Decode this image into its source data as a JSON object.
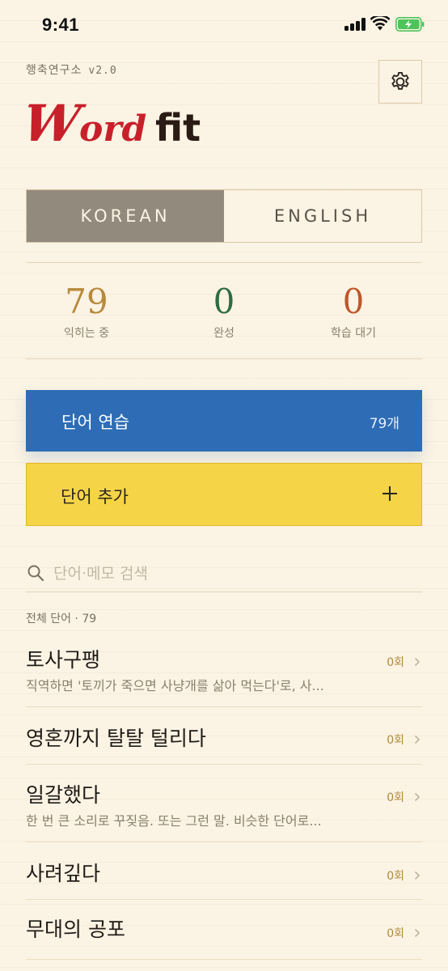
{
  "status_bar": {
    "time": "9:41"
  },
  "header": {
    "org": "행축연구소",
    "version": "v2.0",
    "logo_text": "Wordfit"
  },
  "lang_tabs": [
    {
      "label": "KOREAN",
      "active": true
    },
    {
      "label": "ENGLISH",
      "active": false
    }
  ],
  "stats": [
    {
      "value": "79",
      "label": "익히는 중",
      "color": "#b8893a"
    },
    {
      "value": "0",
      "label": "완성",
      "color": "#2f6b43"
    },
    {
      "value": "0",
      "label": "학습 대기",
      "color": "#c0562a"
    }
  ],
  "practice": {
    "label": "단어 연습",
    "count": "79개"
  },
  "add_word": {
    "label": "단어 추가"
  },
  "search": {
    "placeholder": "단어·메모 검색",
    "value": ""
  },
  "list": {
    "heading": "전체 단어 · 79",
    "items": [
      {
        "word": "토사구팽",
        "desc": "직역하면 '토끼가 죽으면 사냥개를 삶아 먹는다'로, 사...",
        "count": "0회"
      },
      {
        "word": "영혼까지 탈탈 털리다",
        "desc": "",
        "count": "0회"
      },
      {
        "word": "일갈했다",
        "desc": "한 번 큰 소리로 꾸짖음. 또는 그런 말. 비슷한 단어로...",
        "count": "0회"
      },
      {
        "word": "사려깊다",
        "desc": "",
        "count": "0회"
      },
      {
        "word": "무대의 공포",
        "desc": "",
        "count": "0회"
      }
    ]
  },
  "colors": {
    "accent_blue": "#2e6db5",
    "accent_yellow": "#f5d448",
    "logo_red": "#c8202a",
    "logo_dark": "#2a1c14"
  }
}
